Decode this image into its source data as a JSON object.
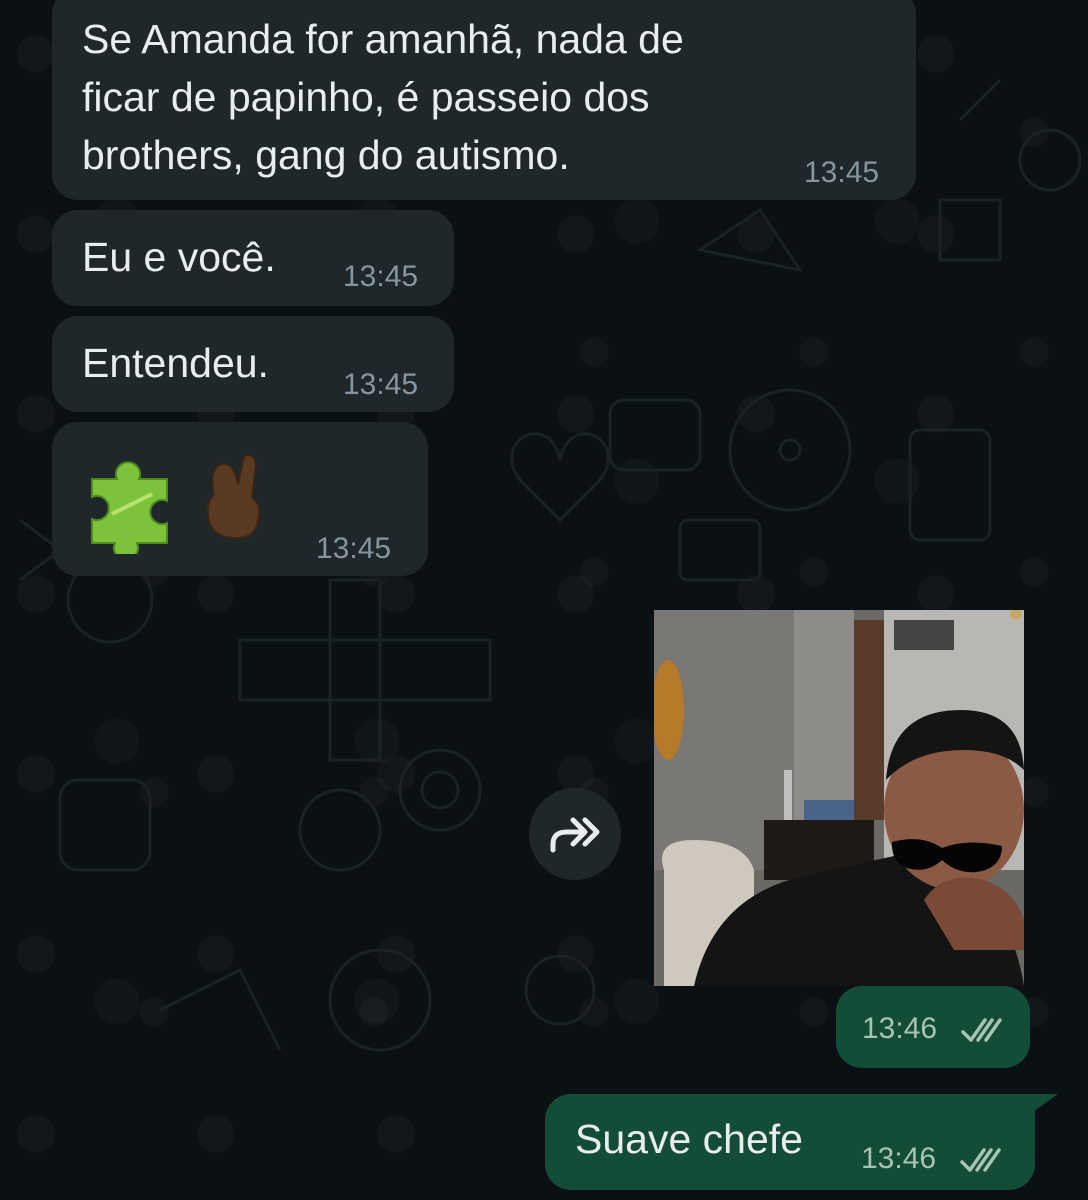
{
  "messages": [
    {
      "id": "m1",
      "direction": "incoming",
      "text": "Se Amanda for amanhã, nada de\nficar de papinho, é passeio dos\nbrothers, gang do autismo.",
      "time": "13:45"
    },
    {
      "id": "m2",
      "direction": "incoming",
      "text": "Eu e você.",
      "time": "13:45"
    },
    {
      "id": "m3",
      "direction": "incoming",
      "text": "Entendeu.",
      "time": "13:45"
    },
    {
      "id": "m4",
      "direction": "incoming",
      "emojis": [
        "puzzle-piece",
        "crossed-fingers"
      ],
      "time": "13:45"
    },
    {
      "id": "m5",
      "direction": "outgoing",
      "type": "video-note",
      "time": "13:46",
      "status": "read"
    },
    {
      "id": "m6",
      "direction": "outgoing",
      "text": "Suave chefe",
      "time": "13:46",
      "status": "read"
    }
  ],
  "icons": {
    "forward": "forward-icon",
    "read_receipt": "double-check-icon"
  },
  "colors": {
    "background": "#0b1014",
    "incoming_bubble": "#1f272a",
    "outgoing_bubble": "#144d37",
    "text": "#e9edef",
    "timestamp": "#8696a0",
    "read_check": "#a7c3b5"
  }
}
